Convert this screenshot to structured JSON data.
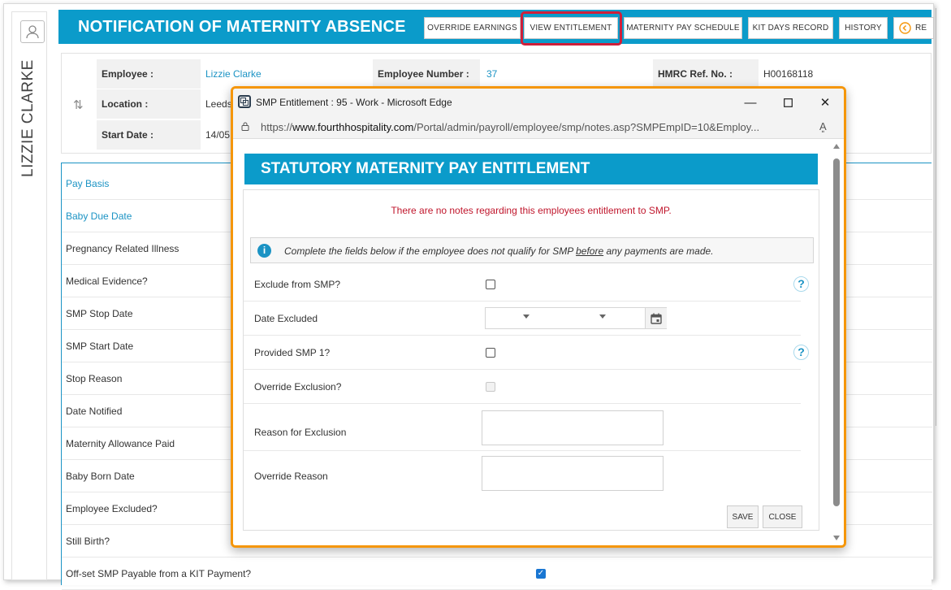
{
  "app": {
    "title": "NOTIFICATION OF MATERNITY ABSENCE",
    "employee_name_vertical": "LIZZIE CLARKE",
    "toolbar": {
      "override_earnings": "OVERRIDE EARNINGS",
      "view_entitlement": "VIEW ENTITLEMENT",
      "maternity_pay_schedule": "MATERNITY PAY SCHEDULE",
      "kit_days_record": "KIT DAYS RECORD",
      "history": "HISTORY",
      "return_partial": "RE"
    },
    "employee_info": {
      "employee_label": "Employee :",
      "employee_value": "Lizzie Clarke",
      "employee_number_label": "Employee Number :",
      "employee_number_value": "37",
      "hmrc_label": "HMRC Ref. No. :",
      "hmrc_value": "H00168118",
      "location_label": "Location :",
      "location_value": "Leeds",
      "start_date_label": "Start Date :",
      "start_date_value": "14/05"
    },
    "details_rows": [
      "Pay Basis",
      "Baby Due Date",
      "Pregnancy Related Illness",
      "Medical Evidence?",
      "SMP Stop Date",
      "SMP Start Date",
      "Stop Reason",
      "Date Notified",
      "Maternity Allowance Paid",
      "Baby Born Date",
      "Employee Excluded?",
      "Still Birth?",
      "Off-set SMP Payable from a KIT Payment?"
    ]
  },
  "popup": {
    "window_title": "SMP Entitlement : 95 - Work - Microsoft Edge",
    "url_prefix": "https://",
    "url_domain": "www.fourthhospitality.com",
    "url_path": "/Portal/admin/payroll/employee/smp/notes.asp?SMPEmpID=10&Employ...",
    "banner": "STATUTORY MATERNITY PAY ENTITLEMENT",
    "no_notes": "There are no notes regarding this employees entitlement to SMP.",
    "info_pre": "Complete the fields below if the employee does not qualify for SMP ",
    "info_emph": "before",
    "info_post": " any payments are made.",
    "fields": {
      "exclude_from_smp": "Exclude from SMP?",
      "date_excluded": "Date Excluded",
      "provided_smp1": "Provided SMP 1?",
      "override_exclusion": "Override Exclusion?",
      "reason_for_exclusion": "Reason for Exclusion",
      "override_reason": "Override Reason"
    },
    "help_symbol": "?",
    "save": "SAVE",
    "close": "CLOSE"
  },
  "colors": {
    "brand_blue": "#0b9bca",
    "highlight_red": "#cf1f3a",
    "popup_border_orange": "#f5960a",
    "error_red": "#c0162c"
  }
}
